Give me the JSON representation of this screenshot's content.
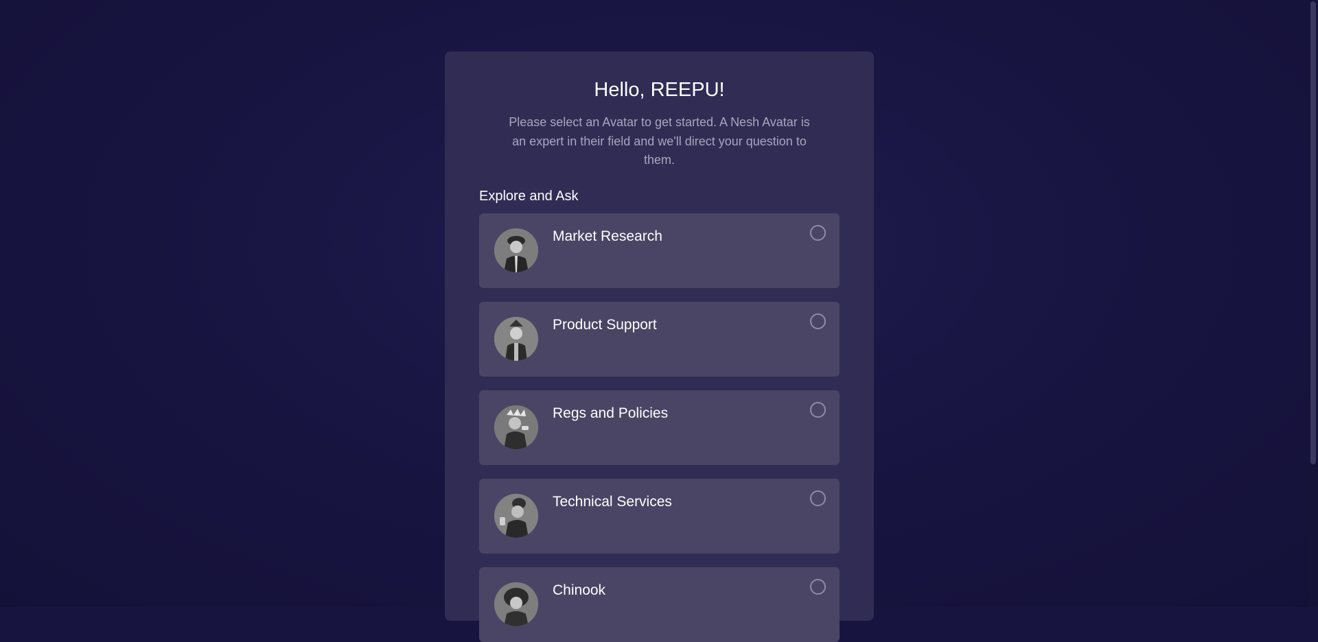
{
  "header": {
    "greeting": "Hello, REEPU!",
    "subtitle": "Please select an Avatar to get started. A Nesh Avatar is an expert in their field and we'll direct your question to them."
  },
  "section": {
    "label": "Explore and Ask"
  },
  "avatars": [
    {
      "name": "Market Research",
      "icon": "market-research-avatar-icon",
      "selected": false
    },
    {
      "name": "Product Support",
      "icon": "product-support-avatar-icon",
      "selected": false
    },
    {
      "name": "Regs and Policies",
      "icon": "regs-policies-avatar-icon",
      "selected": false
    },
    {
      "name": "Technical Services",
      "icon": "technical-services-avatar-icon",
      "selected": false
    },
    {
      "name": "Chinook",
      "icon": "chinook-avatar-icon",
      "selected": false
    }
  ],
  "colors": {
    "background": "#171440",
    "panel": "#302c54",
    "card": "#4a4565",
    "text": "#ffffff",
    "muted_text": "#a8a6bd"
  }
}
